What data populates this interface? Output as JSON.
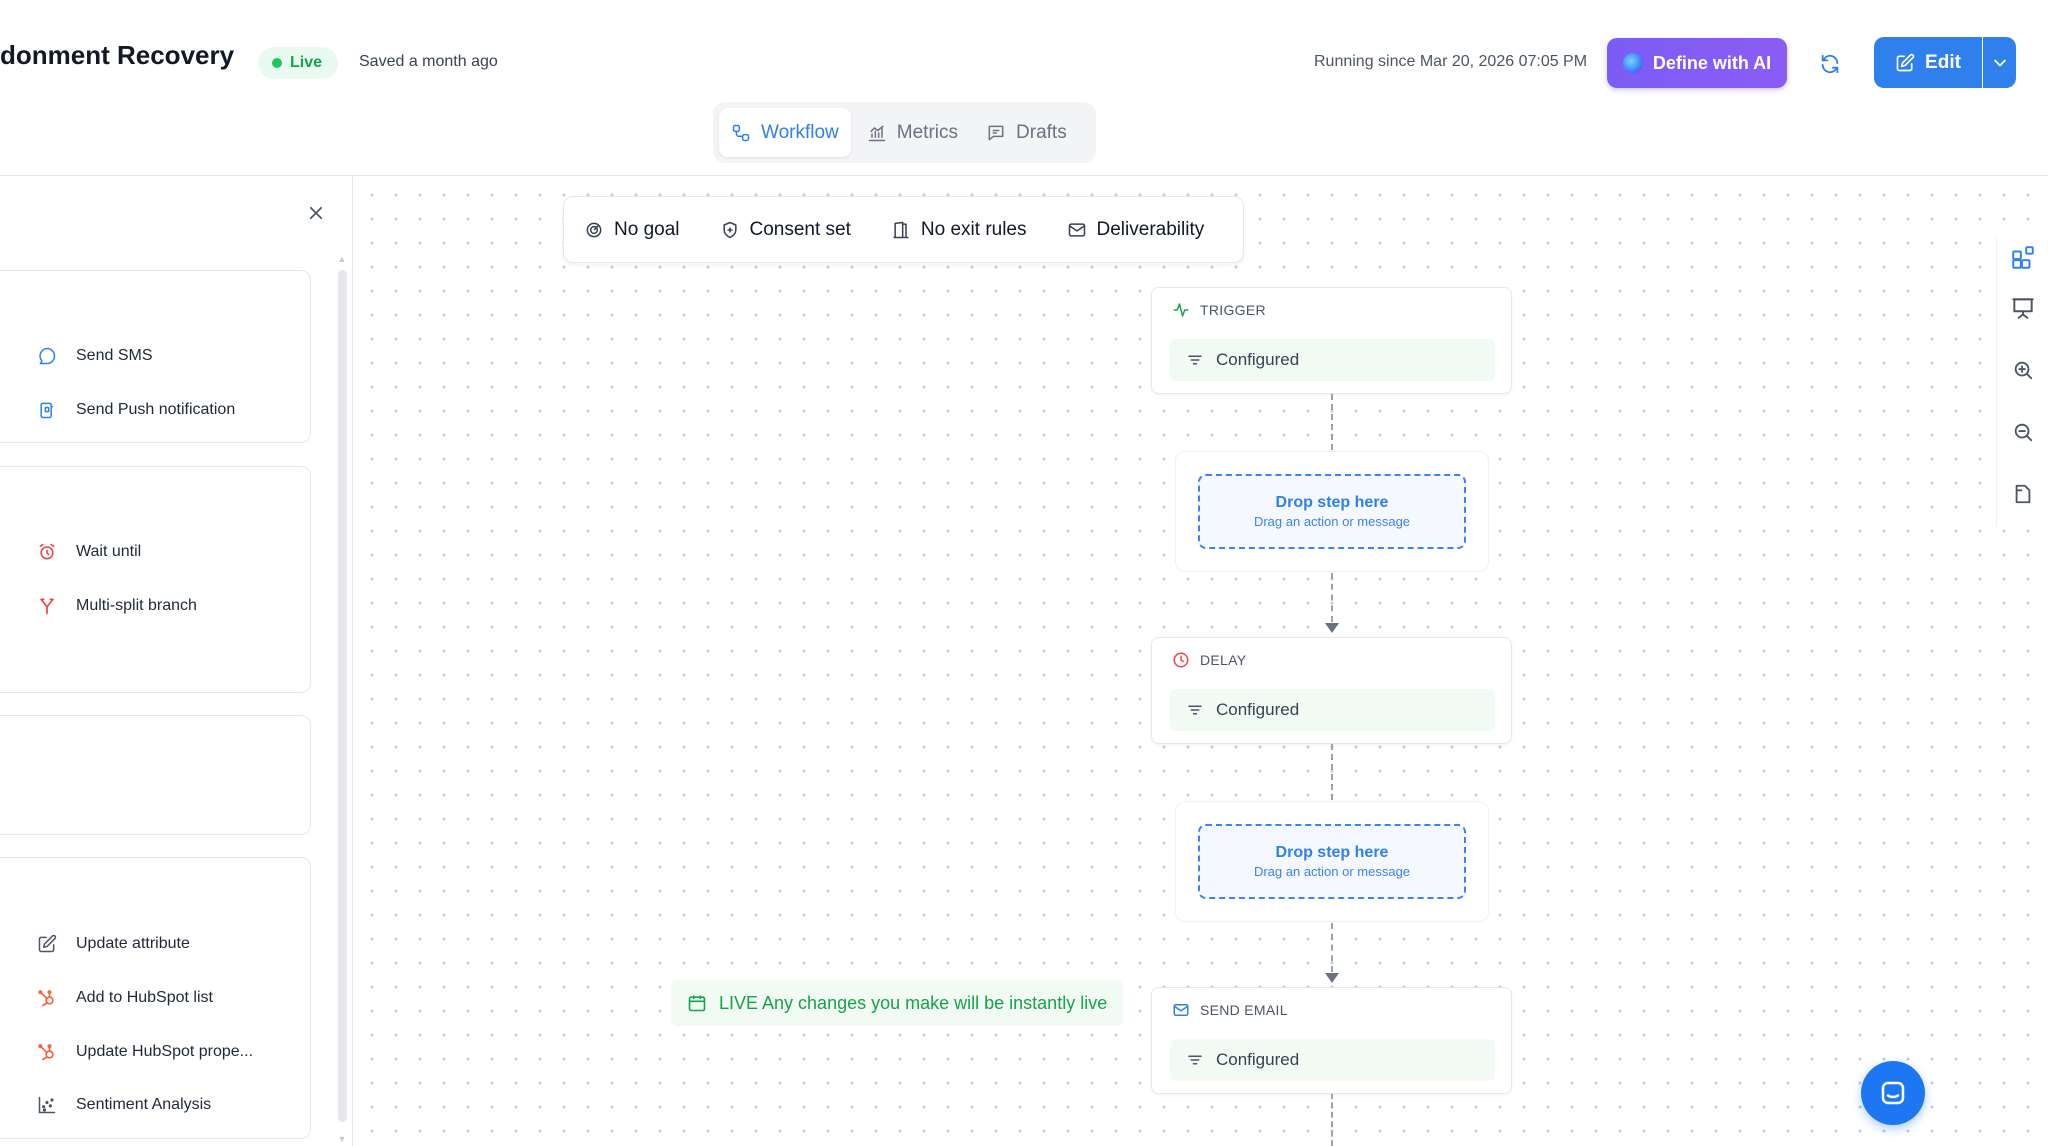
{
  "header": {
    "title": "donment Recovery",
    "status_label": "Live",
    "saved_text": "Saved a month ago",
    "running_text": "Running since Mar 20, 2026 07:05 PM",
    "ai_button_label": "Define with AI",
    "edit_button_label": "Edit"
  },
  "tabs": [
    {
      "label": "Workflow",
      "icon": "workflow-icon",
      "active": true
    },
    {
      "label": "Metrics",
      "icon": "metrics-icon",
      "active": false
    },
    {
      "label": "Drafts",
      "icon": "drafts-icon",
      "active": false
    }
  ],
  "panel": {
    "groups": [
      {
        "items": [
          {
            "label": "Send SMS",
            "icon": "message-circle-icon"
          },
          {
            "label": "Send Push notification",
            "icon": "mobile-push-icon"
          }
        ]
      },
      {
        "items": [
          {
            "label": "Wait until",
            "icon": "alarm-clock-icon"
          },
          {
            "label": "Multi-split branch",
            "icon": "branch-split-icon"
          }
        ]
      },
      {
        "items": []
      },
      {
        "items": [
          {
            "label": "Update attribute",
            "icon": "edit-square-icon"
          },
          {
            "label": "Add to HubSpot list",
            "icon": "hubspot-icon"
          },
          {
            "label": "Update HubSpot prope...",
            "icon": "hubspot-icon"
          },
          {
            "label": "Sentiment Analysis",
            "icon": "scatter-chart-icon"
          }
        ]
      }
    ]
  },
  "toolbar": {
    "goal_label": "No goal",
    "consent_label": "Consent set",
    "exit_label": "No exit rules",
    "deliverability_label": "Deliverability"
  },
  "flow": {
    "trigger": {
      "label": "TRIGGER",
      "status": "Configured"
    },
    "drop1": {
      "title": "Drop step here",
      "subtitle": "Drag an action or message"
    },
    "delay": {
      "label": "DELAY",
      "status": "Configured"
    },
    "drop2": {
      "title": "Drop step here",
      "subtitle": "Drag an action or message"
    },
    "send_email": {
      "label": "SEND EMAIL",
      "status": "Configured"
    }
  },
  "live_note": "LIVE Any changes you make will be instantly live",
  "colors": {
    "accent": "#2f80ed",
    "ai_purple": "#7c5cf6",
    "live_green": "#16a34a",
    "delay_red": "#ef4444"
  }
}
